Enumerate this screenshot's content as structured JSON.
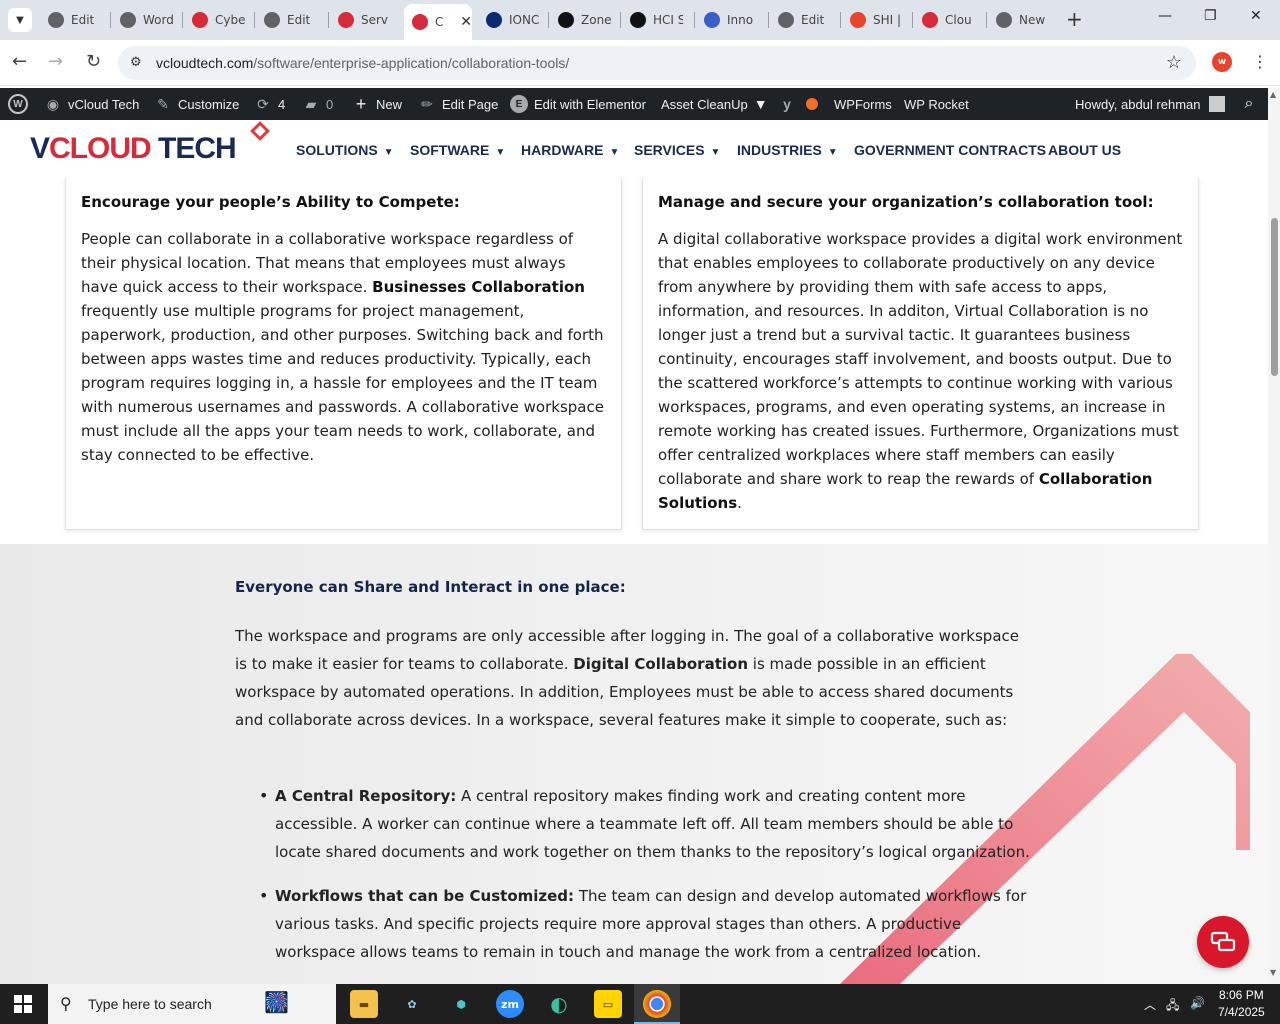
{
  "browser": {
    "tabs": [
      {
        "title": "Edit",
        "icon": "globe-icon",
        "color": "#5f6368"
      },
      {
        "title": "Word",
        "icon": "globe-icon",
        "color": "#5f6368"
      },
      {
        "title": "Cybe",
        "icon": "vcloud-favicon",
        "color": "#d52b3a"
      },
      {
        "title": "Edit",
        "icon": "globe-icon",
        "color": "#5f6368"
      },
      {
        "title": "Serv",
        "icon": "vcloud-favicon",
        "color": "#d52b3a"
      },
      {
        "title": "C",
        "icon": "vcloud-favicon",
        "color": "#d52b3a",
        "active": true
      },
      {
        "title": "IONC",
        "icon": "ionos-favicon",
        "color": "#0b2a6f"
      },
      {
        "title": "Zone",
        "icon": "zone-favicon",
        "color": "#111111"
      },
      {
        "title": "HCI S",
        "icon": "hci-favicon",
        "color": "#111111"
      },
      {
        "title": "Inno",
        "icon": "inno-favicon",
        "color": "#3b5fc4"
      },
      {
        "title": "Edit",
        "icon": "globe-icon",
        "color": "#5f6368"
      },
      {
        "title": "SHI |",
        "icon": "shi-favicon",
        "color": "#e8442e"
      },
      {
        "title": "Clou",
        "icon": "cloud-favicon",
        "color": "#d52b3a"
      },
      {
        "title": "New",
        "icon": "chrome-newtab-icon",
        "color": "#5f6368"
      }
    ],
    "url_domain": "vcloudtech.com",
    "url_path": "/software/enterprise-application/collaboration-tools/",
    "profile_initial": "w"
  },
  "wpbar": {
    "site": "vCloud Tech",
    "customize": "Customize",
    "updates_count": "4",
    "comments_count": "0",
    "new": "New",
    "edit_page": "Edit Page",
    "edit_elementor": "Edit with Elementor",
    "asset_cleanup": "Asset CleanUp",
    "wpforms": "WPForms",
    "wp_rocket": "WP Rocket",
    "howdy": "Howdy, abdul rehman"
  },
  "header": {
    "logo_v": "V",
    "logo_cloud": "CLOUD",
    "logo_tech": " TECH",
    "nav": [
      {
        "label": "SOLUTIONS",
        "dropdown": true
      },
      {
        "label": "SOFTWARE",
        "dropdown": true
      },
      {
        "label": "HARDWARE",
        "dropdown": true
      },
      {
        "label": "SERVICES",
        "dropdown": true
      },
      {
        "label": "INDUSTRIES",
        "dropdown": true
      },
      {
        "label": "GOVERNMENT CONTRACTS",
        "dropdown": false
      },
      {
        "label": "ABOUT US",
        "dropdown": false
      }
    ]
  },
  "cards": {
    "left": {
      "heading": "Encourage your people’s Ability to Compete:",
      "p1": "People can collaborate in a collaborative workspace regardless of their physical location. That means that employees must always have quick access to their workspace. ",
      "bold": "Businesses Collaboration",
      "p2": " frequently use multiple programs for project management, paperwork, production, and other purposes. Switching back and forth between apps wastes time and reduces productivity. Typically, each program requires logging in, a hassle for employees and the IT team with numerous usernames and passwords. A collaborative workspace must include all the apps your team needs to work, collaborate, and stay connected to be effective."
    },
    "right": {
      "heading": "Manage and secure your organization’s collaboration tool:",
      "p1": "A digital collaborative workspace provides a digital work environment that enables employees to collaborate productively on any device from anywhere by providing them with safe access to apps, information, and resources. In additon, Virtual Collaboration is no longer just a trend but a survival tactic. It guarantees business continuity, encourages staff involvement, and boosts output. Due to the scattered workforce’s attempts to continue working with various workspaces, programs, and even operating systems, an increase in remote working has created issues. Furthermore, Organizations must offer centralized workplaces where staff members can easily collaborate and share work to reap the rewards of ",
      "bold": "Collaboration Solutions",
      "p2": "."
    }
  },
  "section": {
    "heading": "Everyone can Share and Interact in one place:",
    "intro_a": "The workspace and programs are only accessible after logging in. The goal of a collaborative workspace is to make it easier for teams to collaborate. ",
    "intro_bold": "Digital Collaboration",
    "intro_b": " is made possible in an efficient workspace by automated operations. In addition, Employees must be able to access shared documents and collaborate across devices. In a workspace, several features make it simple to cooperate, such as:",
    "bullets": [
      {
        "term": "A Central Repository:",
        "text": " A central repository makes finding work and creating content more accessible. A worker can continue where a teammate left off. All team members should be able to locate shared documents and work together on them thanks to the repository’s logical organization."
      },
      {
        "term": "Workflows that can be Customized:",
        "text": " The team can design and develop automated workflows for various tasks. And specific projects require more approval stages than others. A productive workspace allows teams to remain in touch and manage the work from a centralized location."
      }
    ]
  },
  "taskbar": {
    "search_placeholder": "Type here to search",
    "time": "8:06 PM",
    "date": "7/4/2025"
  }
}
